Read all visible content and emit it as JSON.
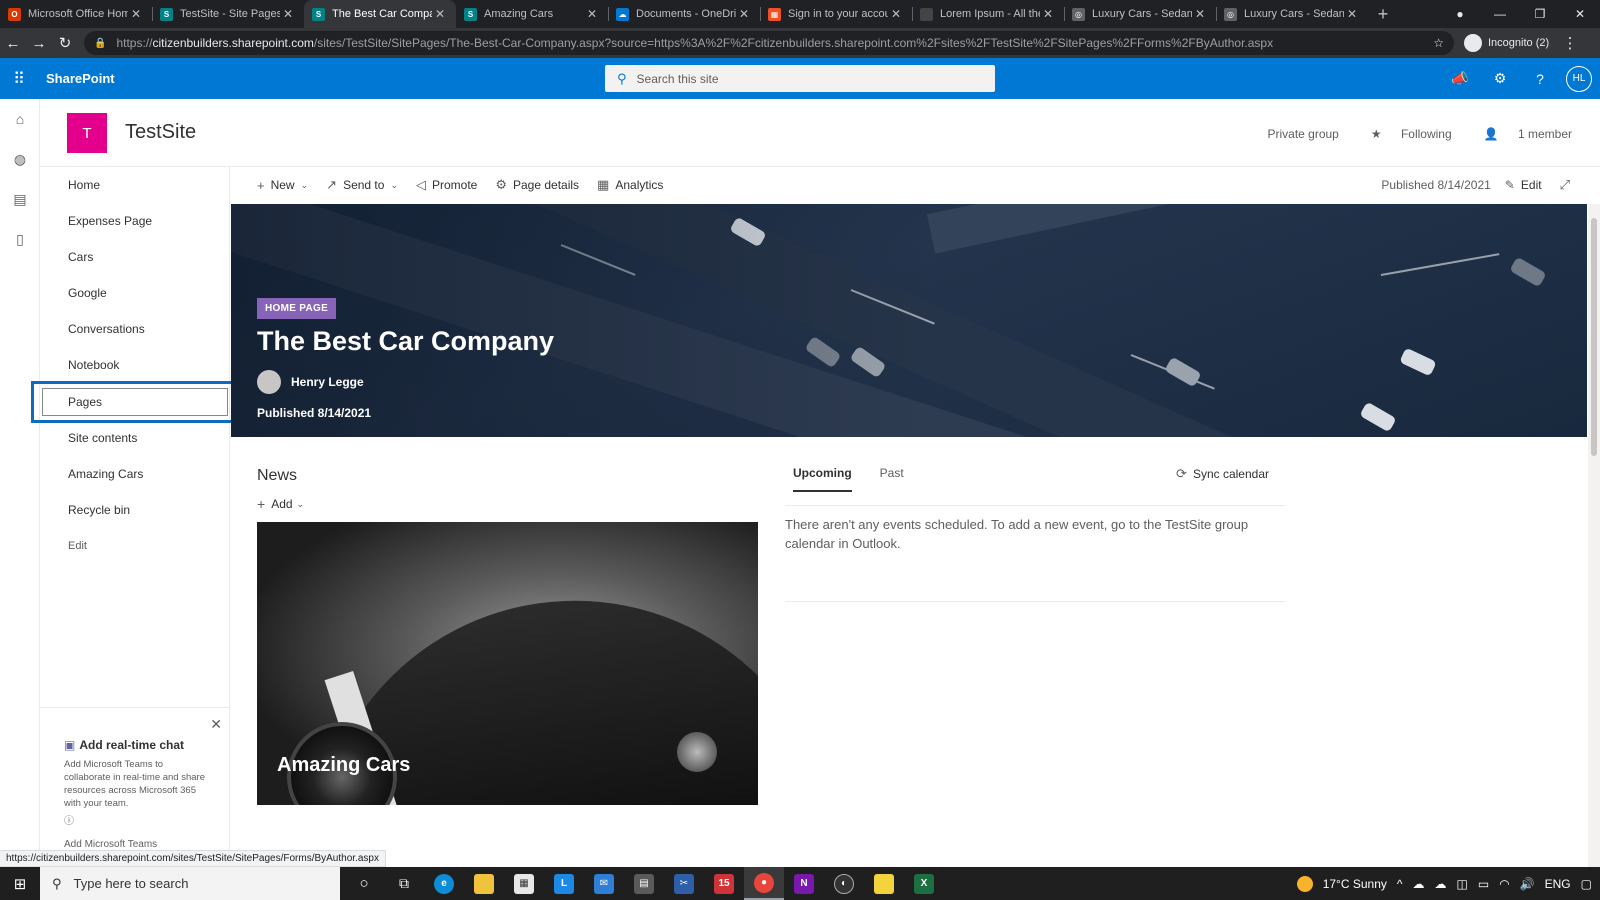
{
  "browser": {
    "tabs": [
      {
        "title": "Microsoft Office Home",
        "fav_color": "#d83b01",
        "fav_glyph": "O",
        "active": false
      },
      {
        "title": "TestSite - Site Pages -",
        "fav_color": "#038387",
        "fav_glyph": "S",
        "active": false
      },
      {
        "title": "The Best Car Company",
        "fav_color": "#038387",
        "fav_glyph": "S",
        "active": true
      },
      {
        "title": "Amazing Cars",
        "fav_color": "#038387",
        "fav_glyph": "S",
        "active": false
      },
      {
        "title": "Documents - OneDrive",
        "fav_color": "#0078d4",
        "fav_glyph": "☁",
        "active": false
      },
      {
        "title": "Sign in to your account",
        "fav_color": "#f25022",
        "fav_glyph": "▦",
        "active": false
      },
      {
        "title": "Lorem Ipsum - All the",
        "fav_color": "#444444",
        "fav_glyph": "",
        "active": false
      },
      {
        "title": "Luxury Cars - Sedans,",
        "fav_color": "#5f6368",
        "fav_glyph": "◎",
        "active": false
      },
      {
        "title": "Luxury Cars - Sedans,",
        "fav_color": "#5f6368",
        "fav_glyph": "◎",
        "active": false
      }
    ],
    "url_prefix": "https://",
    "url_host": "citizenbuilders.sharepoint.com",
    "url_path": "/sites/TestSite/SitePages/The-Best-Car-Company.aspx?source=https%3A%2F%2Fcitizenbuilders.sharepoint.com%2Fsites%2FTestSite%2FSitePages%2FForms%2FByAuthor.aspx",
    "incognito_label": "Incognito (2)",
    "status_url": "https://citizenbuilders.sharepoint.com/sites/TestSite/SitePages/Forms/ByAuthor.aspx"
  },
  "suite": {
    "brand": "SharePoint",
    "search_placeholder": "Search this site",
    "avatar_initials": "HL",
    "color": "#0078d4"
  },
  "site": {
    "logo_letter": "T",
    "logo_color": "#e3008c",
    "name": "TestSite",
    "privacy": "Private group",
    "following": "Following",
    "members": "1 member"
  },
  "nav": {
    "items": [
      "Home",
      "Expenses Page",
      "Cars",
      "Google",
      "Conversations",
      "Notebook",
      "Pages",
      "Site contents",
      "Amazing Cars",
      "Recycle bin"
    ],
    "edit": "Edit",
    "selected": "Pages"
  },
  "teams_card": {
    "title": "Add real-time chat",
    "body": "Add Microsoft Teams to collaborate in real-time and share resources across Microsoft 365 with your team.",
    "link": "Add Microsoft Teams"
  },
  "command_bar": {
    "new": "New",
    "send_to": "Send to",
    "promote": "Promote",
    "page_details": "Page details",
    "analytics": "Analytics",
    "published": "Published 8/14/2021",
    "edit": "Edit"
  },
  "hero": {
    "tag": "HOME PAGE",
    "title": "The Best Car Company",
    "author": "Henry Legge",
    "published": "Published 8/14/2021"
  },
  "news": {
    "title": "News",
    "add": "Add",
    "card_caption": "Amazing Cars"
  },
  "events": {
    "tab_upcoming": "Upcoming",
    "tab_past": "Past",
    "sync": "Sync calendar",
    "message": "There aren't any events scheduled. To add a new event, go to the TestSite group calendar in Outlook."
  },
  "taskbar": {
    "search_placeholder": "Type here to search",
    "weather": "17°C  Sunny",
    "lang": "ENG"
  }
}
